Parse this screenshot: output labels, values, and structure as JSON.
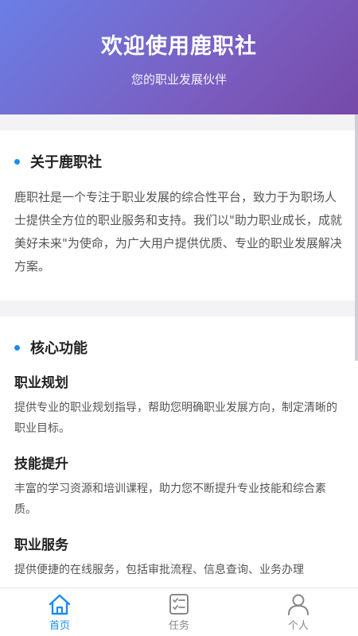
{
  "header": {
    "title": "欢迎使用鹿职社",
    "subtitle": "您的职业发展伙伴"
  },
  "about": {
    "title": "关于鹿职社",
    "text": "鹿职社是一个专注于职业发展的综合性平台，致力于为职场人士提供全方位的职业服务和支持。我们以\"助力职业成长，成就美好未来\"为使命，为广大用户提供优质、专业的职业发展解决方案。"
  },
  "features": {
    "title": "核心功能",
    "items": [
      {
        "title": "职业规划",
        "desc": "提供专业的职业规划指导，帮助您明确职业发展方向，制定清晰的职业目标。"
      },
      {
        "title": "技能提升",
        "desc": "丰富的学习资源和培训课程，助力您不断提升专业技能和综合素质。"
      },
      {
        "title": "职业服务",
        "desc": "提供便捷的在线服务，包括审批流程、信息查询、业务办理"
      }
    ]
  },
  "tabs": [
    {
      "label": "首页",
      "icon": "home-icon",
      "active": true
    },
    {
      "label": "任务",
      "icon": "task-icon",
      "active": false
    },
    {
      "label": "个人",
      "icon": "user-icon",
      "active": false
    }
  ],
  "colors": {
    "accent": "#1d8cf0",
    "header_start": "#6a7fe6",
    "header_end": "#764aa8"
  }
}
